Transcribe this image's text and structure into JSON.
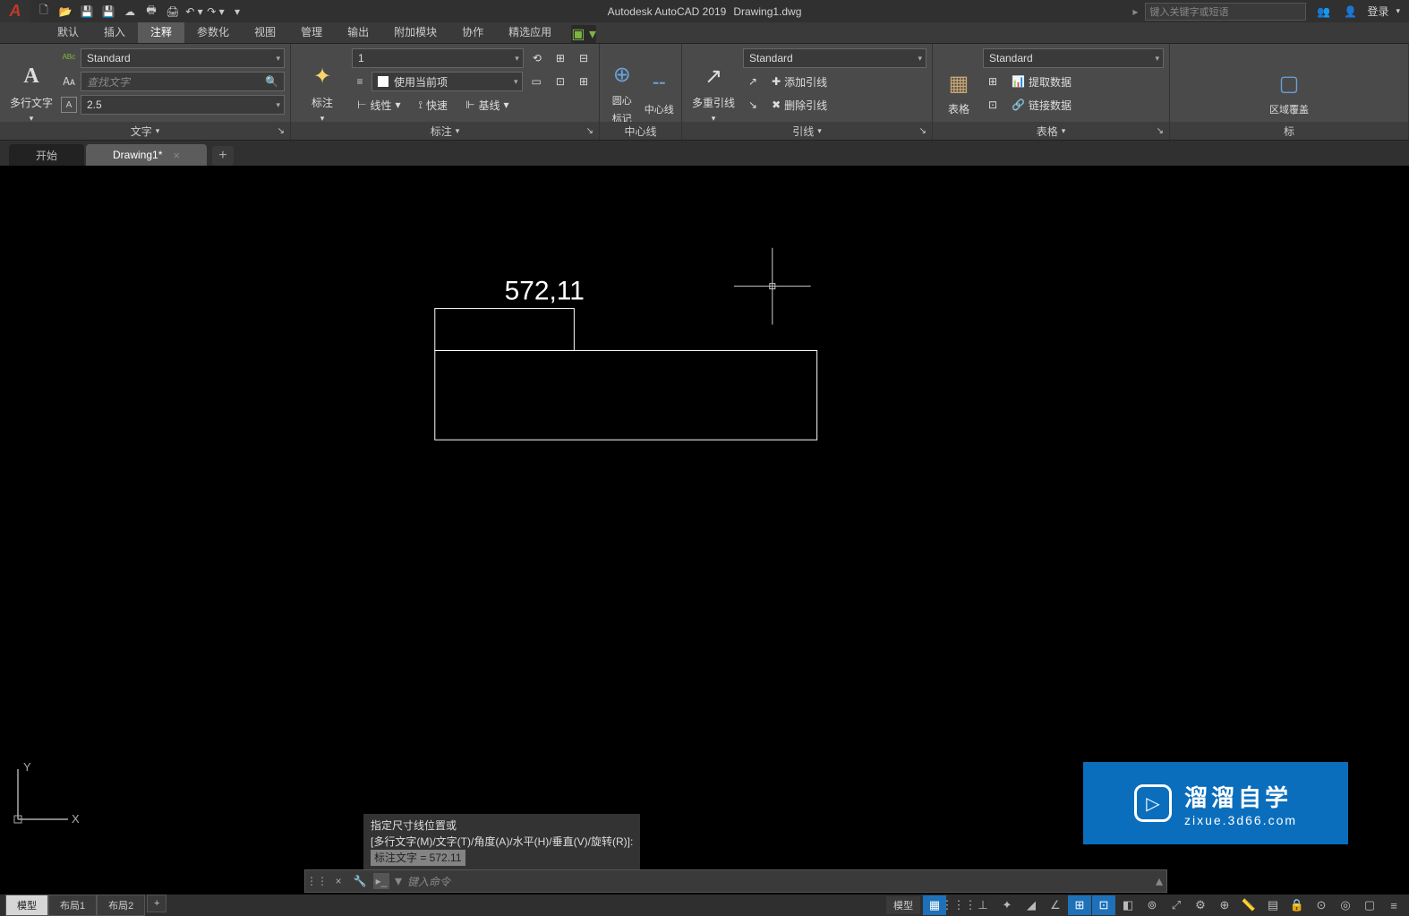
{
  "title": {
    "app": "Autodesk AutoCAD 2019",
    "file": "Drawing1.dwg"
  },
  "search_placeholder": "键入关键字或短语",
  "login": "登录",
  "menus": [
    "默认",
    "插入",
    "注释",
    "参数化",
    "视图",
    "管理",
    "输出",
    "附加模块",
    "协作",
    "精选应用"
  ],
  "active_menu": 2,
  "ribbon": {
    "text": {
      "title": "文字",
      "multiline": "多行文字",
      "style": "Standard",
      "search_placeholder": "查找文字",
      "height": "2.5"
    },
    "dim": {
      "title": "标注",
      "label": "标注",
      "scale": "1",
      "layer": "使用当前项",
      "linear": "线性",
      "quick": "快速",
      "baseline": "基线"
    },
    "center": {
      "title": "中心线",
      "circle": "圆心",
      "line": "中心线",
      "mark": "标记"
    },
    "leader": {
      "title": "引线",
      "multi": "多重引线",
      "style": "Standard",
      "add": "添加引线",
      "remove": "删除引线"
    },
    "table": {
      "title": "表格",
      "label": "表格",
      "style": "Standard",
      "extract": "提取数据",
      "link": "链接数据"
    },
    "wipeout": {
      "title": "标",
      "label": "区域覆盖"
    }
  },
  "filetabs": {
    "start": "开始",
    "active": "Drawing1*",
    "add": "+"
  },
  "drawing": {
    "dim_text": "572,11"
  },
  "command": {
    "hist1": "指定尺寸线位置或",
    "hist2": "[多行文字(M)/文字(T)/角度(A)/水平(H)/垂直(V)/旋转(R)]:",
    "hist3": "标注文字 = 572.11",
    "placeholder": "键入命令"
  },
  "watermark": {
    "main": "溜溜自学",
    "sub": "zixue.3d66.com"
  },
  "layouts": [
    "模型",
    "布局1",
    "布局2"
  ],
  "status": {
    "model": "模型"
  },
  "ucs": {
    "x": "X",
    "y": "Y"
  }
}
